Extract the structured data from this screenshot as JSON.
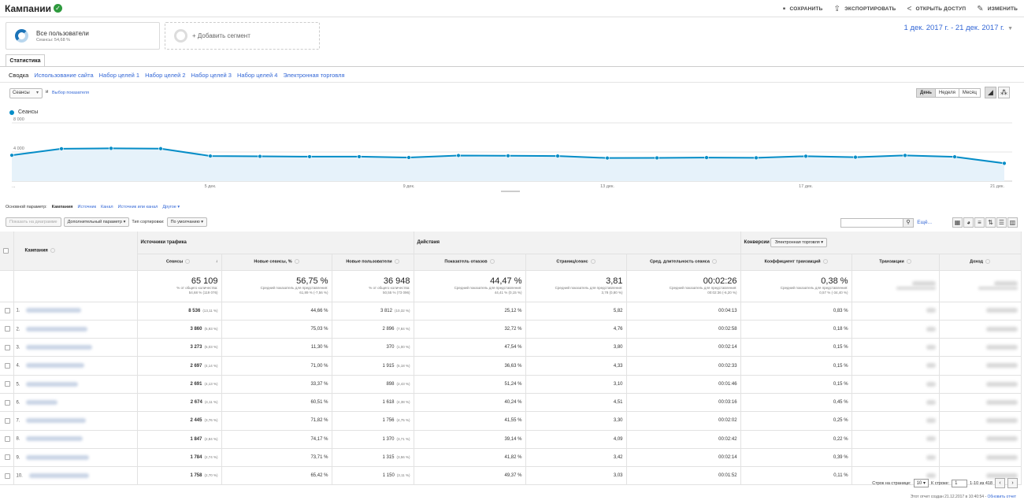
{
  "header": {
    "title": "Кампании",
    "save": "СОХРАНИТЬ",
    "export": "ЭКСПОРТИРОВАТЬ",
    "share": "ОТКРЫТЬ ДОСТУП",
    "edit": "ИЗМЕНИТЬ"
  },
  "segments": {
    "active": {
      "name": "Все пользователи",
      "sub": "Сеансы: 54,68 %"
    },
    "add": "+ Добавить сегмент"
  },
  "date_range": "1 дек. 2017 г. - 21 дек. 2017 г.",
  "tab": "Статистика",
  "subtabs": [
    "Сводка",
    "Использование сайта",
    "Набор целей 1",
    "Набор целей 2",
    "Набор целей 3",
    "Набор целей 4",
    "Электронная торговля"
  ],
  "metric": {
    "select": "Сеансы",
    "and": "и",
    "choose": "Выбор показателя"
  },
  "granularity": [
    "День",
    "Неделя",
    "Месяц"
  ],
  "chart_data": {
    "type": "area",
    "series": [
      {
        "name": "Сеансы",
        "values": [
          3550,
          4450,
          4500,
          4460,
          3450,
          3400,
          3360,
          3360,
          3240,
          3520,
          3480,
          3450,
          3170,
          3190,
          3230,
          3200,
          3420,
          3280,
          3530,
          3340,
          2450
        ]
      }
    ],
    "x_ticks": [
      "...",
      "5 дек.",
      "9 дек.",
      "13 дек.",
      "17 дек.",
      "21 дек."
    ],
    "y_ticks": [
      "8 000",
      "4 000"
    ],
    "ylim": [
      0,
      8000
    ],
    "color": "#058dc7"
  },
  "primary_dim": {
    "label": "Основной параметр:",
    "options": [
      "Кампания",
      "Источник",
      "Канал",
      "Источник или канал",
      "Другое ▾"
    ]
  },
  "secondary": {
    "plot": "Показать на диаграмме",
    "param": "Дополнительный параметр",
    "sort_label": "Тип сортировки:",
    "sort_value": "По умолчанию"
  },
  "search_more": "Ещё...",
  "table": {
    "group_source": "Источники трафика",
    "group_action": "Действия",
    "group_conv": "Конверсии",
    "conv_select": "Электронная торговля",
    "col_campaign": "Кампания",
    "columns": [
      "Сеансы",
      "Новые сеансы, %",
      "Новые пользователи",
      "Показатель отказов",
      "Страниц/сеанс",
      "Сред. длительность сеанса",
      "Коэффициент транзакций",
      "Транзакции",
      "Доход"
    ],
    "totals": [
      {
        "big": "65 109",
        "sub1": "% от общего количества:",
        "sub2": "54,68 % (119 076)"
      },
      {
        "big": "56,75 %",
        "sub1": "Средний показатель для представления:",
        "sub2": "61,89 % (-7,56 %)"
      },
      {
        "big": "36 948",
        "sub1": "% от общего количества:",
        "sub2": "50,55 % (73 096)"
      },
      {
        "big": "44,47 %",
        "sub1": "Средний показатель для представления:",
        "sub2": "44,41 % (0,15 %)"
      },
      {
        "big": "3,81",
        "sub1": "Средний показатель для представления:",
        "sub2": "3,78 (0,80 %)"
      },
      {
        "big": "00:02:26",
        "sub1": "Средний показатель для представления:",
        "sub2": "00:02:36 (-6,20 %)"
      },
      {
        "big": "0,38 %",
        "sub1": "Средний показатель для представления:",
        "sub2": "0,57 % (-34,40 %)"
      }
    ],
    "rows": [
      {
        "n": "1.",
        "s": "8 536",
        "sp": "(13,11 %)",
        "ns": "44,66 %",
        "nu": "3 812",
        "nup": "(10,32 %)",
        "br": "25,12 %",
        "pps": "5,82",
        "dur": "00:04:13",
        "cr": "0,83 %"
      },
      {
        "n": "2.",
        "s": "3 860",
        "sp": "(5,93 %)",
        "ns": "75,03 %",
        "nu": "2 896",
        "nup": "(7,84 %)",
        "br": "32,72 %",
        "pps": "4,76",
        "dur": "00:02:58",
        "cr": "0,18 %"
      },
      {
        "n": "3.",
        "s": "3 273",
        "sp": "(5,03 %)",
        "ns": "11,30 %",
        "nu": "370",
        "nup": "(1,00 %)",
        "br": "47,54 %",
        "pps": "3,80",
        "dur": "00:02:14",
        "cr": "0,15 %"
      },
      {
        "n": "4.",
        "s": "2 697",
        "sp": "(4,14 %)",
        "ns": "71,00 %",
        "nu": "1 915",
        "nup": "(5,18 %)",
        "br": "36,63 %",
        "pps": "4,33",
        "dur": "00:02:33",
        "cr": "0,15 %"
      },
      {
        "n": "5.",
        "s": "2 691",
        "sp": "(4,13 %)",
        "ns": "33,37 %",
        "nu": "898",
        "nup": "(2,43 %)",
        "br": "51,24 %",
        "pps": "3,10",
        "dur": "00:01:46",
        "cr": "0,15 %"
      },
      {
        "n": "6.",
        "s": "2 674",
        "sp": "(4,11 %)",
        "ns": "60,51 %",
        "nu": "1 618",
        "nup": "(4,38 %)",
        "br": "40,24 %",
        "pps": "4,51",
        "dur": "00:03:16",
        "cr": "0,45 %"
      },
      {
        "n": "7.",
        "s": "2 445",
        "sp": "(3,76 %)",
        "ns": "71,82 %",
        "nu": "1 756",
        "nup": "(4,75 %)",
        "br": "41,55 %",
        "pps": "3,30",
        "dur": "00:02:02",
        "cr": "0,25 %"
      },
      {
        "n": "8.",
        "s": "1 847",
        "sp": "(2,84 %)",
        "ns": "74,17 %",
        "nu": "1 370",
        "nup": "(3,71 %)",
        "br": "39,14 %",
        "pps": "4,09",
        "dur": "00:02:42",
        "cr": "0,22 %"
      },
      {
        "n": "9.",
        "s": "1 784",
        "sp": "(2,74 %)",
        "ns": "73,71 %",
        "nu": "1 315",
        "nup": "(3,56 %)",
        "br": "41,82 %",
        "pps": "3,42",
        "dur": "00:02:14",
        "cr": "0,39 %"
      },
      {
        "n": "10.",
        "s": "1 758",
        "sp": "(2,70 %)",
        "ns": "65,42 %",
        "nu": "1 150",
        "nup": "(3,11 %)",
        "br": "49,37 %",
        "pps": "3,03",
        "dur": "00:01:52",
        "cr": "0,11 %"
      }
    ]
  },
  "pager": {
    "rows_label": "Строк на странице:",
    "rows_value": "10",
    "goto_label": "К строке:",
    "goto_value": "1",
    "range": "1-10 из 418"
  },
  "footer": {
    "text": "Этот отчет создан 21.12.2017 в 10:40:54 - ",
    "refresh": "Обновить отчет"
  }
}
